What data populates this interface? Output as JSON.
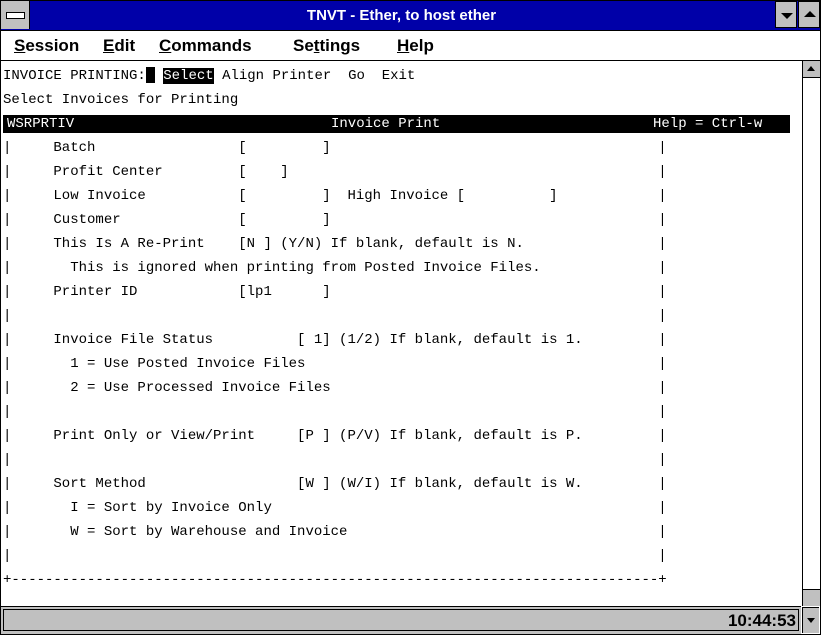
{
  "window": {
    "title": "TNVT - Ether, to host ether",
    "colors": {
      "titlebar": "#0000a8",
      "chrome": "#c0c0c0",
      "screen_bg": "#ffffff",
      "screen_fg": "#000000"
    }
  },
  "menubar": {
    "items": [
      {
        "label": "Session",
        "mnemonic": "S"
      },
      {
        "label": "Edit",
        "mnemonic": "E"
      },
      {
        "label": "Commands",
        "mnemonic": "C"
      },
      {
        "label": "Settings",
        "mnemonic": "t"
      },
      {
        "label": "Help",
        "mnemonic": "H"
      }
    ]
  },
  "terminal": {
    "command_prompt": "INVOICE PRINTING:",
    "commands": [
      "Select",
      "Align Printer",
      "Go",
      "Exit"
    ],
    "selected_command": "Select",
    "subtitle": "Select Invoices for Printing",
    "header": {
      "program": "WSRPRTIV",
      "screen_title": "Invoice Print",
      "help_hint": "Help = Ctrl-w"
    },
    "lines": [
      "|     Batch                 [         ]                                       |",
      "|     Profit Center         [    ]                                            |",
      "|     Low Invoice           [         ]  High Invoice [          ]            |",
      "|     Customer              [         ]                                       |",
      "|     This Is A Re-Print    [N ] (Y/N) If blank, default is N.                |",
      "|       This is ignored when printing from Posted Invoice Files.              |",
      "|     Printer ID            [lp1      ]                                       |",
      "|                                                                             |",
      "|     Invoice File Status          [ 1] (1/2) If blank, default is 1.         |",
      "|       1 = Use Posted Invoice Files                                          |",
      "|       2 = Use Processed Invoice Files                                       |",
      "|                                                                             |",
      "|     Print Only or View/Print     [P ] (P/V) If blank, default is P.         |",
      "|                                                                             |",
      "|     Sort Method                  [W ] (W/I) If blank, default is W.         |",
      "|       I = Sort by Invoice Only                                              |",
      "|       W = Sort by Warehouse and Invoice                                     |",
      "|                                                                             |",
      "+-----------------------------------------------------------------------------+"
    ]
  },
  "statusbar": {
    "clock": "10:44:53"
  }
}
